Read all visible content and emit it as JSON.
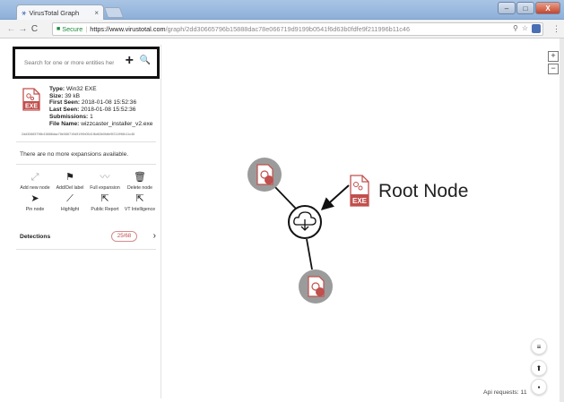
{
  "browser": {
    "tab_title": "VirusTotal Graph",
    "tab_close": "×",
    "secure_label": "Secure",
    "url_host": "https://www.virustotal.com",
    "url_path": "/graph/2dd30665796b15888dac78e066719d9199b0541f6d63b0fdfe9f211996b11c46",
    "window_buttons": {
      "minimize": "–",
      "maximize": "□",
      "close": "X"
    }
  },
  "sidebar": {
    "search": {
      "placeholder": "Search for one or more entities here",
      "add": "+",
      "search": "🔍"
    },
    "file": {
      "icon_label": "EXE",
      "type_key": "Type:",
      "type_val": " Win32 EXE",
      "size_key": "Size:",
      "size_val": " 39 kB",
      "first_key": "First Seen:",
      "first_val": " 2018-01-08 15:52:36",
      "last_key": "Last Seen:",
      "last_val": " 2018-01-08 15:52:36",
      "subs_key": "Submissions:",
      "subs_val": " 1",
      "name_key": "File Name:",
      "name_val": " wizzcaster_installer_v2.exe",
      "hash": "2dd30665796b15888dac78e066719d9199b0541f6d63b0fdfe9f211996b11c46"
    },
    "expansions_text": "There are no more expansions available.",
    "actions": [
      {
        "icon": "⤢",
        "label": "Add new node",
        "light": true
      },
      {
        "icon": "⚑",
        "label": "Add/Del label",
        "light": false
      },
      {
        "icon": "〰",
        "label": "Full expansion",
        "light": true
      },
      {
        "icon": "🗑",
        "label": "Delete node",
        "light": false
      },
      {
        "icon": "➤",
        "label": "Pin node",
        "light": false
      },
      {
        "icon": "⟋",
        "label": "Highlight",
        "light": false
      },
      {
        "icon": "⇱",
        "label": "Public Report",
        "light": false
      },
      {
        "icon": "⇱",
        "label": "VT Intelligence",
        "light": false
      }
    ],
    "detections": {
      "label": "Detections",
      "value": "25/68",
      "arrow": "›"
    }
  },
  "canvas": {
    "root_label": "Root Node",
    "exe_label": "EXE",
    "zoom_in": "+",
    "zoom_out": "−",
    "fab_menu": "≡",
    "fab_upload": "⬆",
    "fab_comment": "▪",
    "api_requests": "Api requests: 11"
  },
  "colors": {
    "accent_red": "#c0504d",
    "node_gray": "#9b9b9b",
    "secure_green": "#1c8b3a"
  }
}
